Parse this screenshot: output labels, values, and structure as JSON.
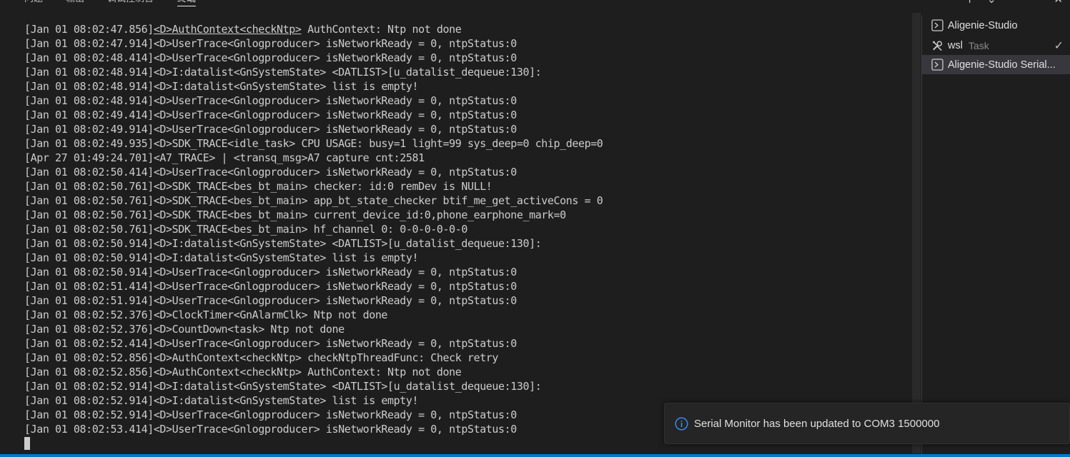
{
  "panel": {
    "tabs": [
      {
        "label": "问题",
        "active": false
      },
      {
        "label": "输出",
        "active": false
      },
      {
        "label": "调试控制台",
        "active": false
      },
      {
        "label": "终端",
        "active": true
      }
    ],
    "actions": {
      "add": "+",
      "dropdown": "⌄",
      "more": "···",
      "maximize": "^",
      "close": "✕"
    }
  },
  "terminal": {
    "lines": [
      "[Jan 01 08:02:47.856]<D>AuthContext<checkNtp> AuthContext: Ntp not done",
      "[Jan 01 08:02:47.914]<D>UserTrace<Gnlogproducer> isNetworkReady = 0, ntpStatus:0",
      "[Jan 01 08:02:48.414]<D>UserTrace<Gnlogproducer> isNetworkReady = 0, ntpStatus:0",
      "[Jan 01 08:02:48.914]<D>I:datalist<GnSystemState> <DATLIST>[u_datalist_dequeue:130]:",
      "[Jan 01 08:02:48.914]<D>I:datalist<GnSystemState> list is empty!",
      "[Jan 01 08:02:48.914]<D>UserTrace<Gnlogproducer> isNetworkReady = 0, ntpStatus:0",
      "[Jan 01 08:02:49.414]<D>UserTrace<Gnlogproducer> isNetworkReady = 0, ntpStatus:0",
      "[Jan 01 08:02:49.914]<D>UserTrace<Gnlogproducer> isNetworkReady = 0, ntpStatus:0",
      "[Jan 01 08:02:49.935]<D>SDK_TRACE<idle_task> CPU USAGE: busy=1 light=99 sys_deep=0 chip_deep=0",
      "[Apr 27 01:49:24.701]<A7_TRACE> | <transq_msg>A7 capture cnt:2581",
      "[Jan 01 08:02:50.414]<D>UserTrace<Gnlogproducer> isNetworkReady = 0, ntpStatus:0",
      "[Jan 01 08:02:50.761]<D>SDK_TRACE<bes_bt_main> checker: id:0 remDev is NULL!",
      "[Jan 01 08:02:50.761]<D>SDK_TRACE<bes_bt_main> app_bt_state_checker btif_me_get_activeCons = 0",
      "[Jan 01 08:02:50.761]<D>SDK_TRACE<bes_bt_main> current_device_id:0,phone_earphone_mark=0",
      "[Jan 01 08:02:50.761]<D>SDK_TRACE<bes_bt_main> hf_channel 0: 0-0-0-0-0-0",
      "[Jan 01 08:02:50.914]<D>I:datalist<GnSystemState> <DATLIST>[u_datalist_dequeue:130]:",
      "[Jan 01 08:02:50.914]<D>I:datalist<GnSystemState> list is empty!",
      "[Jan 01 08:02:50.914]<D>UserTrace<Gnlogproducer> isNetworkReady = 0, ntpStatus:0",
      "[Jan 01 08:02:51.414]<D>UserTrace<Gnlogproducer> isNetworkReady = 0, ntpStatus:0",
      "[Jan 01 08:02:51.914]<D>UserTrace<Gnlogproducer> isNetworkReady = 0, ntpStatus:0",
      "[Jan 01 08:02:52.376]<D>ClockTimer<GnAlarmClk> Ntp not done",
      "[Jan 01 08:02:52.376]<D>CountDown<task> Ntp not done",
      "[Jan 01 08:02:52.414]<D>UserTrace<Gnlogproducer> isNetworkReady = 0, ntpStatus:0",
      "[Jan 01 08:02:52.856]<D>AuthContext<checkNtp> checkNtpThreadFunc: Check retry",
      "[Jan 01 08:02:52.856]<D>AuthContext<checkNtp> AuthContext: Ntp not done",
      "[Jan 01 08:02:52.914]<D>I:datalist<GnSystemState> <DATLIST>[u_datalist_dequeue:130]:",
      "[Jan 01 08:02:52.914]<D>I:datalist<GnSystemState> list is empty!",
      "[Jan 01 08:02:52.914]<D>UserTrace<Gnlogproducer> isNetworkReady = 0, ntpStatus:0",
      "[Jan 01 08:02:53.414]<D>UserTrace<Gnlogproducer> isNetworkReady = 0, ntpStatus:0"
    ],
    "first_line_link": "<D>AuthContext<checkNtp>"
  },
  "terminal_list": [
    {
      "label": "Aligenie-Studio",
      "sub": "",
      "icon": "terminal-icon",
      "selected": false,
      "check": ""
    },
    {
      "label": "wsl",
      "sub": "Task",
      "icon": "tools-icon",
      "selected": false,
      "check": "✓"
    },
    {
      "label": "Aligenie-Studio Serial...",
      "sub": "",
      "icon": "terminal-icon",
      "selected": true,
      "check": ""
    }
  ],
  "notification": {
    "icon": "info-icon",
    "message": "Serial Monitor has been updated to COM3 1500000"
  },
  "colors": {
    "background": "#1e1e1e",
    "text": "#cccccc",
    "accent": "#007acc",
    "info": "#3794ff"
  }
}
